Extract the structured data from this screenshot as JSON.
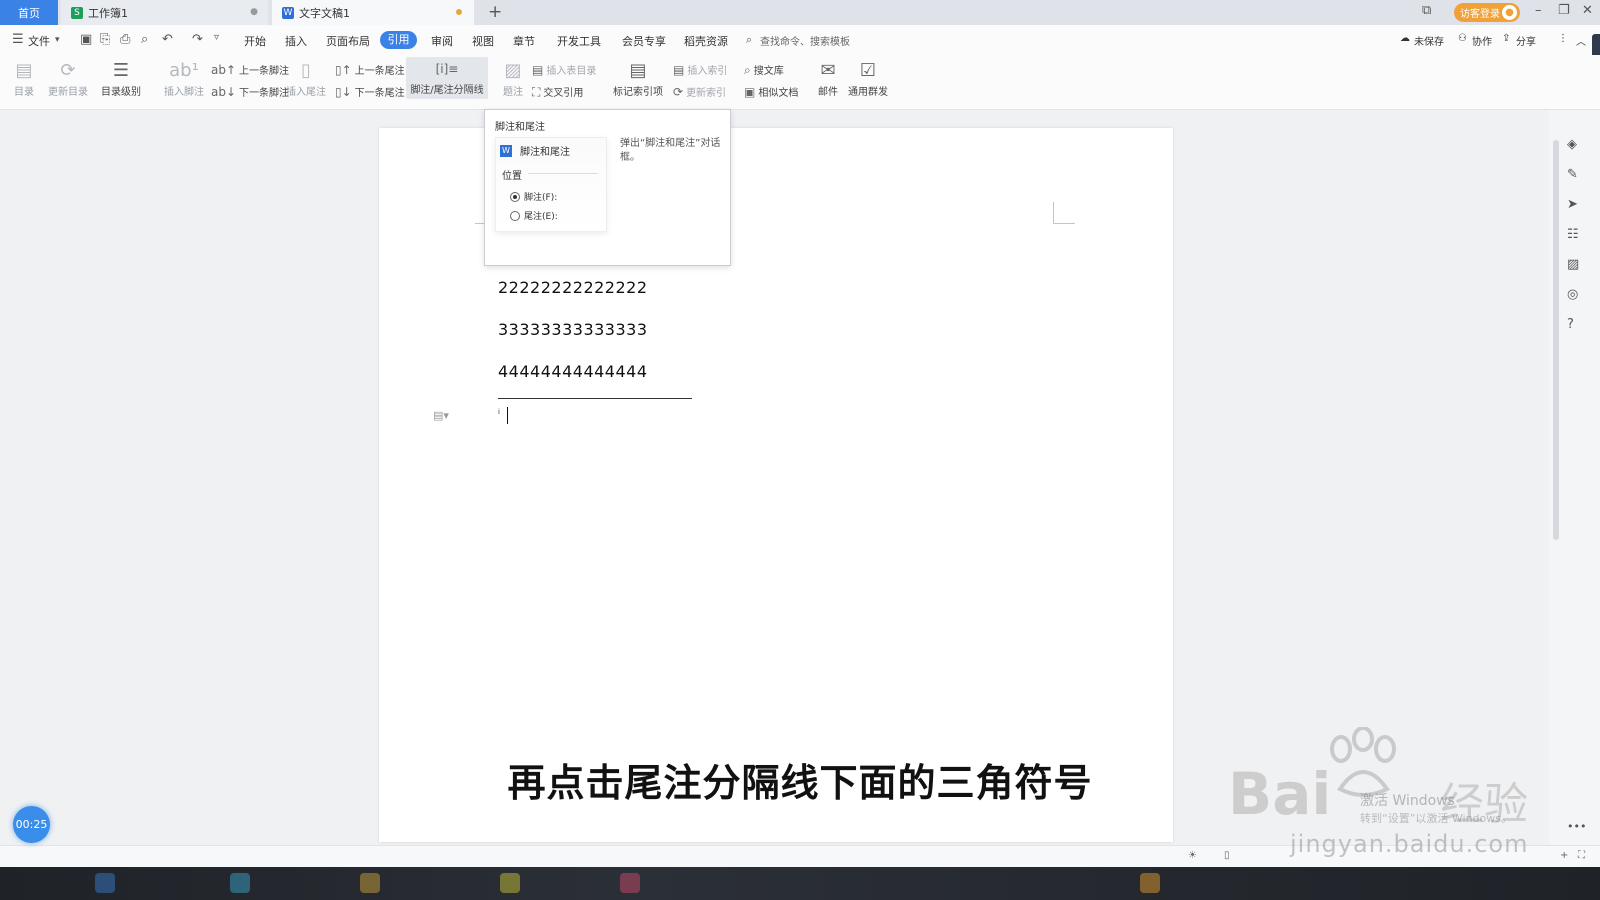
{
  "tabs": {
    "home": "首页",
    "sheet": "工作簿1",
    "doc": "文字文稿1"
  },
  "account": {
    "guest_login": "访客登录"
  },
  "menu": {
    "file": "文件",
    "items": [
      "开始",
      "插入",
      "页面布局",
      "引用",
      "审阅",
      "视图",
      "章节",
      "开发工具",
      "会员专享",
      "稻壳资源"
    ],
    "active": "引用",
    "search": "查找命令、搜索模板",
    "unsaved": "未保存",
    "collab": "协作",
    "share": "分享"
  },
  "ribbon": {
    "toc": "目录",
    "update_toc": "更新目录",
    "toc_level": "目录级别",
    "insert_footnote": "插入脚注",
    "prev_footnote": "上一条脚注",
    "next_footnote": "下一条脚注",
    "insert_endnote": "插入尾注",
    "prev_endnote": "上一条尾注",
    "next_endnote": "下一条尾注",
    "separator": "脚注/尾注分隔线",
    "caption": "题注",
    "insert_table_toc": "插入表目录",
    "cross_ref": "交叉引用",
    "mark_index": "标记索引项",
    "insert_index": "插入索引",
    "update_index": "更新索引",
    "search_lib": "搜文库",
    "similar_docs": "相似文档",
    "mail": "邮件",
    "mass_send": "通用群发"
  },
  "popup": {
    "title": "脚注和尾注",
    "preview_title": "脚注和尾注",
    "position_label": "位置",
    "footnote_option": "脚注(F):",
    "endnote_option": "尾注(E):",
    "description": "弹出“脚注和尾注”对话框。"
  },
  "document": {
    "lines": [
      "22222222222222",
      "33333333333333",
      "44444444444444"
    ],
    "endnote_mark": "i"
  },
  "timer": "00:25",
  "caption": "再点击尾注分隔线下面的三角符号",
  "watermark": {
    "brand": "Bai",
    "brand2": "经验",
    "url": "jingyan.baidu.com",
    "activate": "激活 Windows",
    "activate_sub": "转到“设置”以激活 Windows。"
  }
}
